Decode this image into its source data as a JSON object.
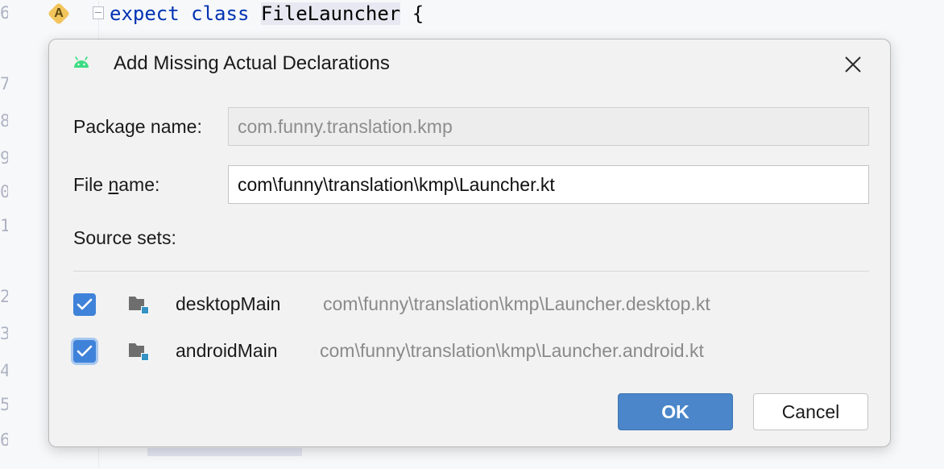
{
  "editor": {
    "gutter_badge": "A",
    "code": {
      "keyword_expect": "expect",
      "keyword_class": "class",
      "class_name": "FileLauncher",
      "brace": "{"
    },
    "line_numbers": [
      "6",
      "7",
      "8",
      "9",
      "0",
      "1",
      "2",
      "3",
      "4",
      "5",
      "6"
    ]
  },
  "dialog": {
    "title": "Add Missing Actual Declarations",
    "title_icon": "android-icon",
    "close_icon": "close-icon",
    "package_label_pre": "Packa",
    "package_label_mnemonic": "g",
    "package_label_post": "e name:",
    "package_value": "com.funny.translation.kmp",
    "file_label_pre": "File ",
    "file_label_mnemonic": "n",
    "file_label_post": "ame:",
    "file_value": "com\\funny\\translation\\kmp\\Launcher.kt",
    "source_sets_label": "Source sets:",
    "source_sets": [
      {
        "name": "desktopMain",
        "path": "com\\funny\\translation\\kmp\\Launcher.desktop.kt",
        "checked": true
      },
      {
        "name": "androidMain",
        "path": "com\\funny\\translation\\kmp\\Launcher.android.kt",
        "checked": true
      }
    ],
    "ok_label": "OK",
    "cancel_label": "Cancel"
  },
  "colors": {
    "accent": "#4a86c9",
    "checkbox": "#3f82d9",
    "android_green": "#3ddc84",
    "keyword": "#0033b3"
  }
}
